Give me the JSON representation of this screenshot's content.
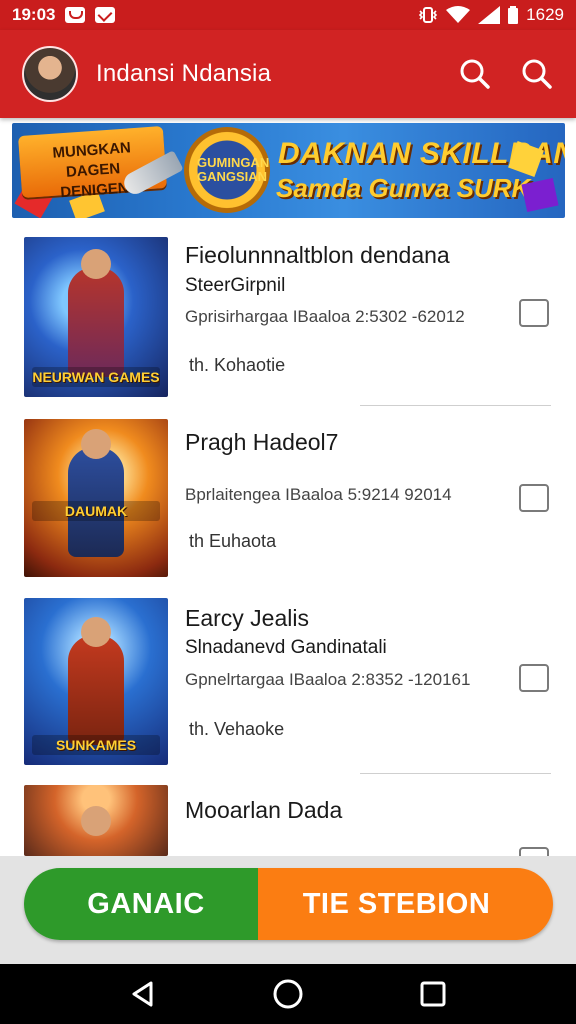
{
  "status_bar": {
    "time": "19:03",
    "battery": "1629",
    "icons": [
      "message-icon",
      "mail-icon",
      "vibrate-icon",
      "wifi-icon",
      "signal-icon",
      "battery-icon"
    ]
  },
  "app_bar": {
    "title": "Indansi Ndansia",
    "avatar": "avatar",
    "actions": [
      "search-icon",
      "search-icon"
    ]
  },
  "banner": {
    "badge_lines": [
      "MUNGKAN",
      "DAGEN",
      "DENIGEN"
    ],
    "medal_text": "GUMINGAN GANGSIAN",
    "headline": "DAKNAN SKILLRAN",
    "subline": "Samda Gunva SURK"
  },
  "items": [
    {
      "title": "Fieolunnnaltblon dendana",
      "subtitle": "SteerGirpnil",
      "meta": "Gprisirhargaa IBaaloa 2:5302 -62012",
      "footer": "th. Kohaotie",
      "thumb_caption": "NEURWAN GAMES",
      "checked": false
    },
    {
      "title": "Pragh Hadeol7",
      "subtitle": "",
      "meta": "Bprlaitengea IBaaloa 5:9214 92014",
      "footer": "th Euhaota",
      "thumb_caption": "DAUMAK",
      "checked": false
    },
    {
      "title": "Earcy Jealis",
      "subtitle": "Slnadanevd Gandinatali",
      "meta": "Gpnelrtargaa IBaaloa 2:8352 -120161",
      "footer": "th. Vehaoke",
      "thumb_caption": "SUNKAMES",
      "checked": false
    },
    {
      "title": "Mooarlan Dada",
      "subtitle": "",
      "meta": "",
      "footer": "",
      "thumb_caption": "",
      "checked": false
    }
  ],
  "action_bar": {
    "left_label": "GANAIC",
    "right_label": "TIE STEBION",
    "left_color": "#2e9a2a",
    "right_color": "#fb7d12"
  },
  "nav_bar": {
    "buttons": [
      "back-icon",
      "home-icon",
      "recents-icon"
    ]
  },
  "colors": {
    "primary": "#d12323",
    "status": "#c91d1d"
  }
}
